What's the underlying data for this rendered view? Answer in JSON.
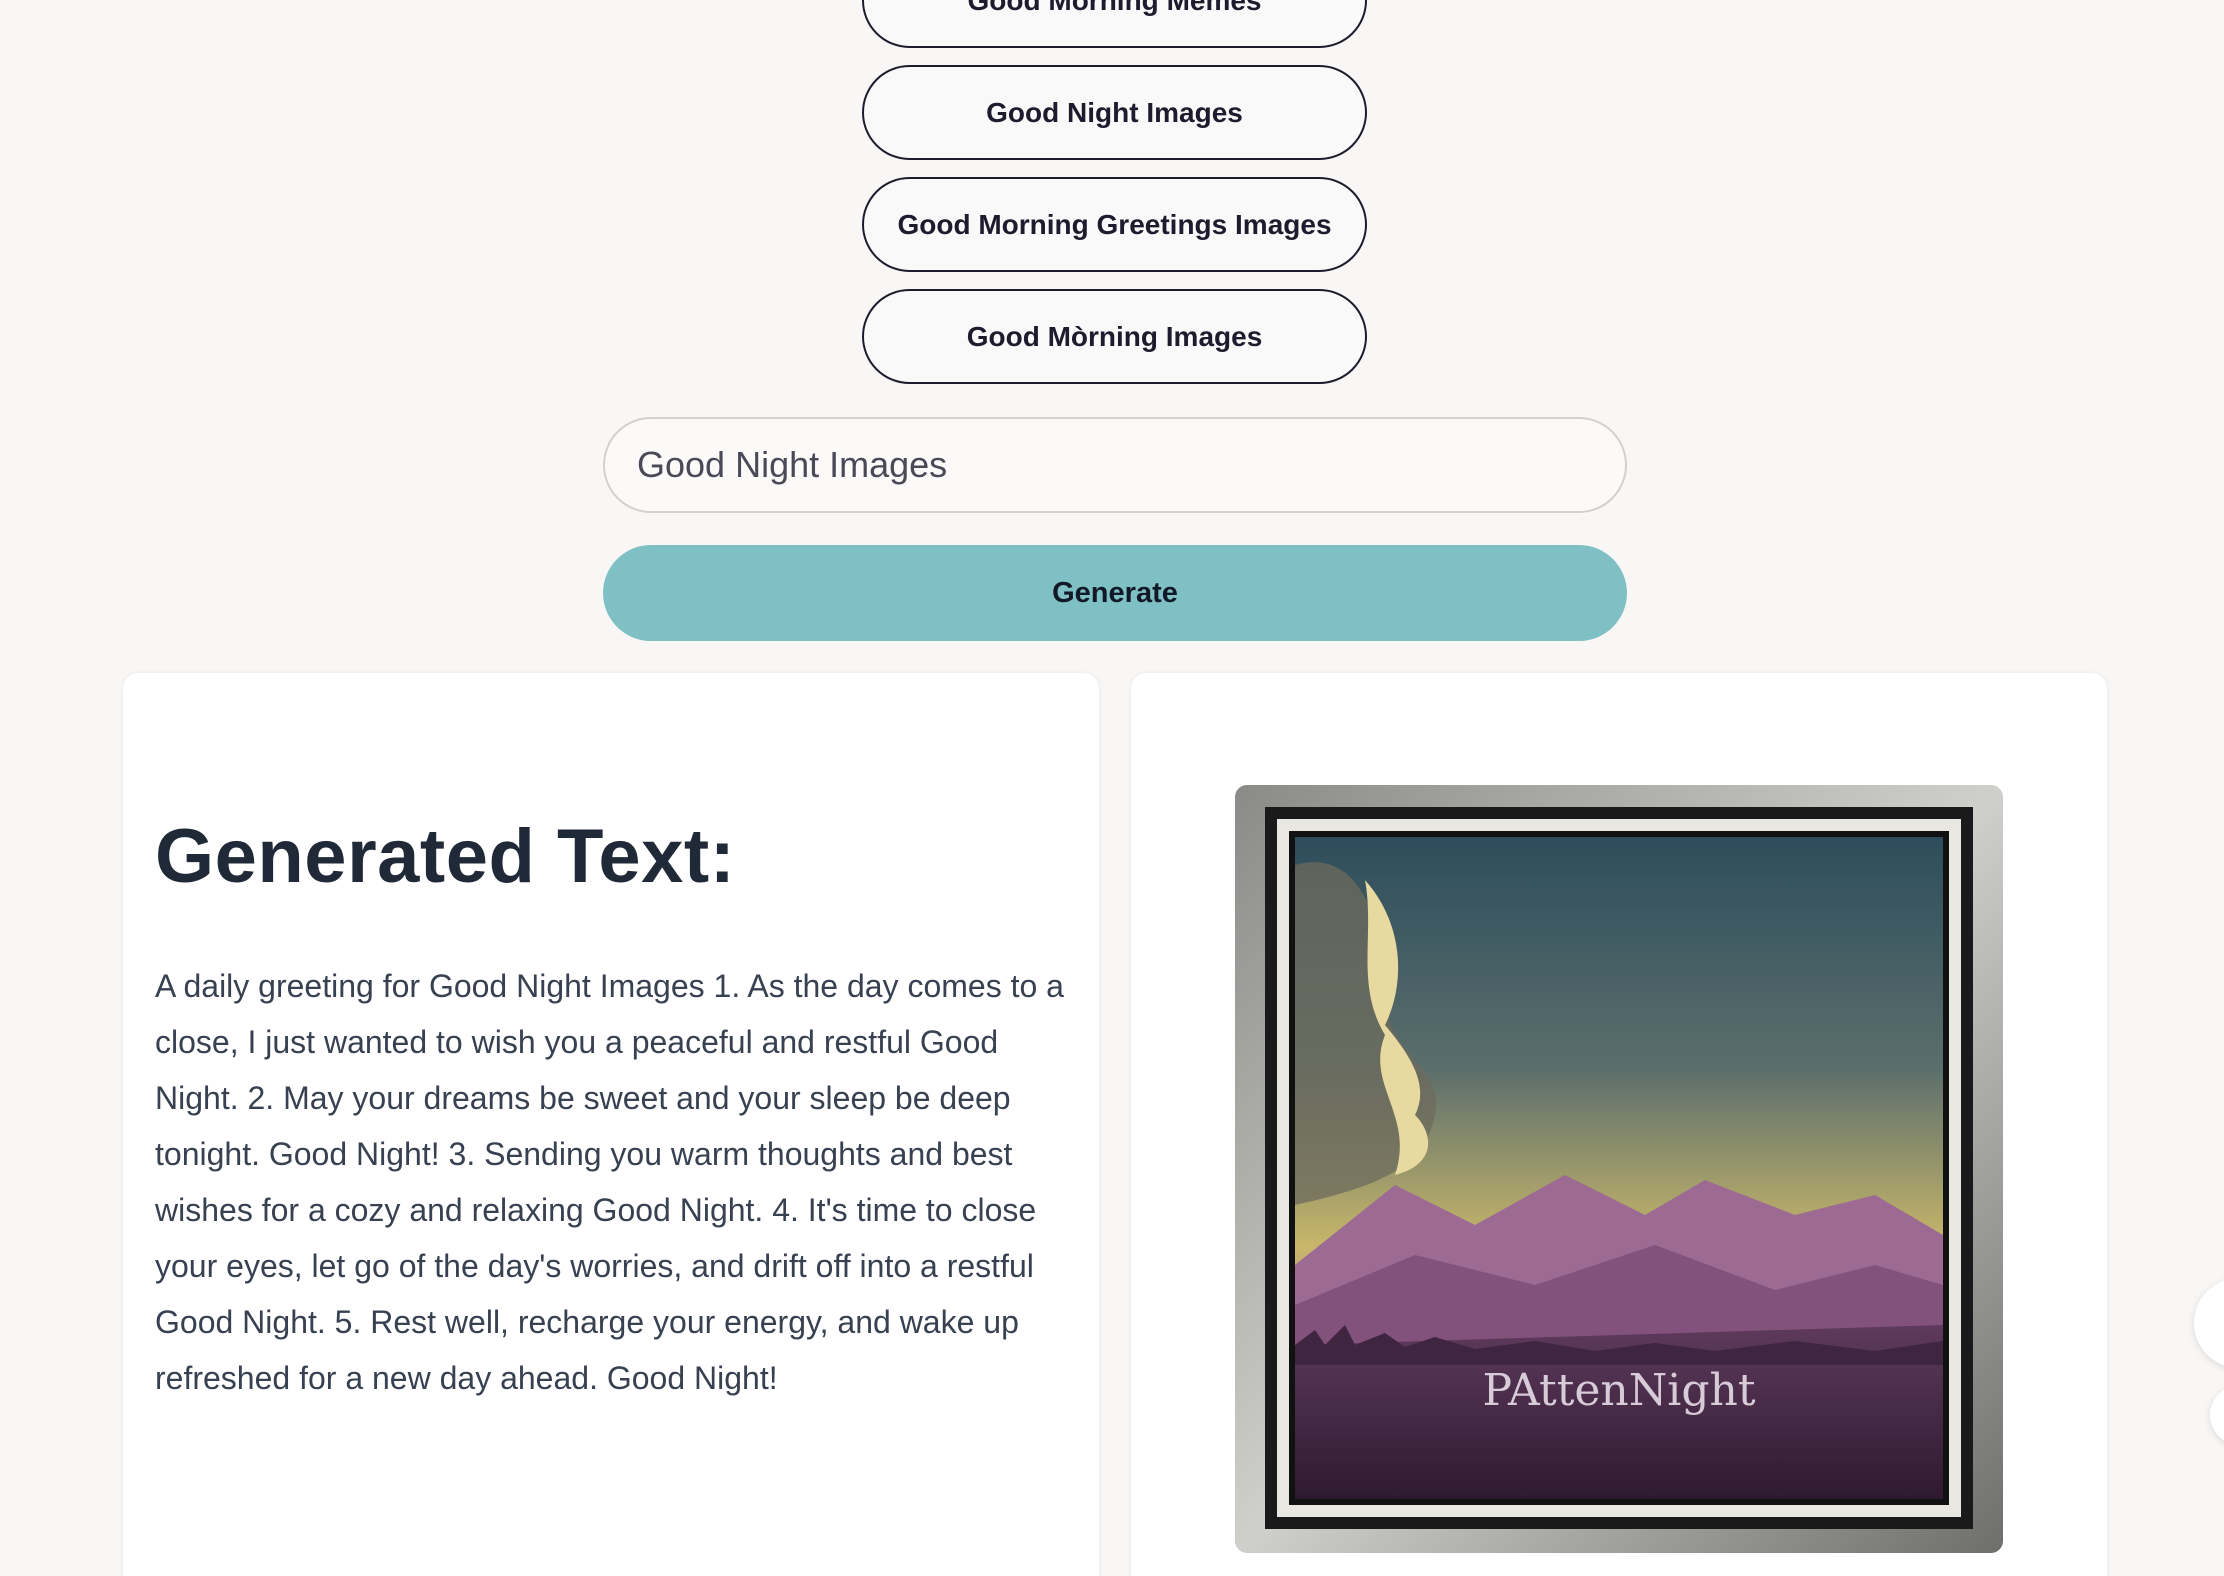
{
  "chips": [
    {
      "label": "Good Morning Memes"
    },
    {
      "label": "Good Night Images"
    },
    {
      "label": "Good Morning Greetings Images"
    },
    {
      "label": "Good Mòrning Images"
    }
  ],
  "search": {
    "value": "Good Night Images"
  },
  "generate_label": "Generate",
  "result": {
    "title": "Generated Text:",
    "text": "A daily greeting for Good Night Images 1. As the day comes to a close, I just wanted to wish you a peaceful and restful Good Night. 2. May your dreams be sweet and your sleep be deep tonight. Good Night! 3. Sending you warm thoughts and best wishes for a cozy and relaxing Good Night. 4. It's time to close your eyes, let go of the day's worries, and drift off into a restful Good Night. 5. Rest well, recharge your energy, and wake up refreshed for a new day ahead. Good Night!"
  },
  "image": {
    "caption": "PAttenNight"
  },
  "colors": {
    "accent": "#7fc0c4",
    "background": "#f9f7f5",
    "chip_border": "#1e1b2e"
  }
}
